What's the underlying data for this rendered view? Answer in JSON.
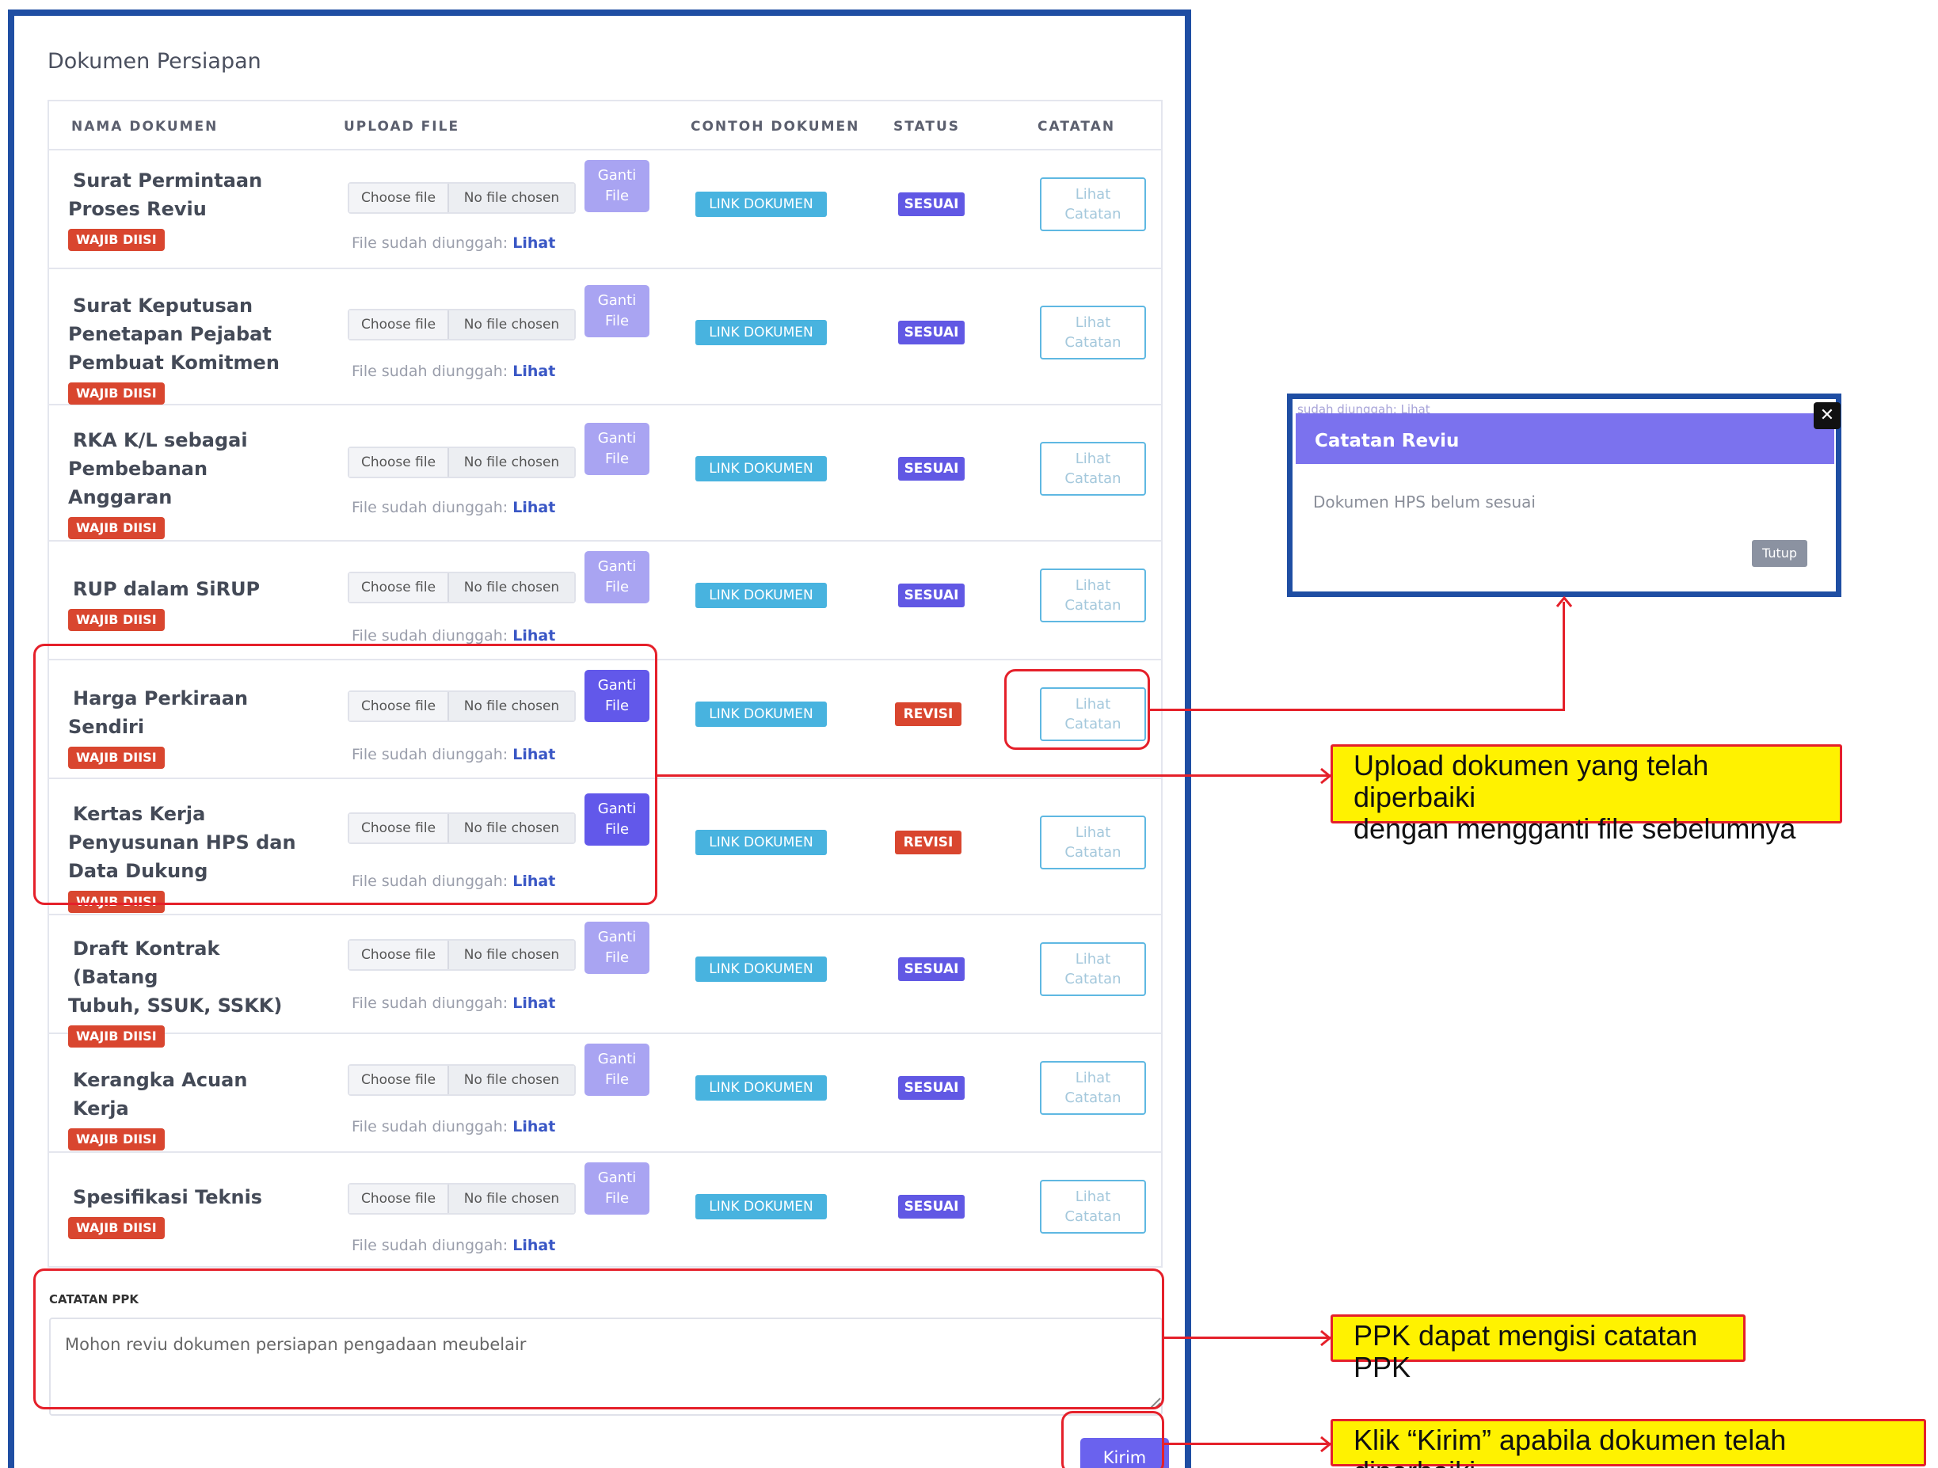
{
  "section_title": "Dokumen Persiapan",
  "table": {
    "headers": [
      "NAMA DOKUMEN",
      "UPLOAD FILE",
      "CONTOH DOKUMEN",
      "STATUS",
      "CATATAN"
    ],
    "rows": [
      {
        "name_lines": [
          "Surat Permintaan",
          "Proses Reviu"
        ],
        "badge": "WAJIB DIISI",
        "choose": "Choose file",
        "no_file": "No file chosen",
        "ganti_lines": [
          "Ganti",
          "File"
        ],
        "uploaded": "File sudah diunggah:",
        "lihat": "Lihat",
        "link": "LINK DOKUMEN",
        "status": "SESUAI",
        "catatan_lines": [
          "Lihat",
          "Catatan"
        ]
      },
      {
        "name_lines": [
          "Surat Keputusan",
          "Penetapan Pejabat",
          "Pembuat Komitmen"
        ],
        "badge": "WAJIB DIISI",
        "choose": "Choose file",
        "no_file": "No file chosen",
        "ganti_lines": [
          "Ganti",
          "File"
        ],
        "uploaded": "File sudah diunggah:",
        "lihat": "Lihat",
        "link": "LINK DOKUMEN",
        "status": "SESUAI",
        "catatan_lines": [
          "Lihat",
          "Catatan"
        ]
      },
      {
        "name_lines": [
          "RKA K/L sebagai",
          "Pembebanan",
          "Anggaran"
        ],
        "badge": "WAJIB DIISI",
        "choose": "Choose file",
        "no_file": "No file chosen",
        "ganti_lines": [
          "Ganti",
          "File"
        ],
        "uploaded": "File sudah diunggah:",
        "lihat": "Lihat",
        "link": "LINK DOKUMEN",
        "status": "SESUAI",
        "catatan_lines": [
          "Lihat",
          "Catatan"
        ]
      },
      {
        "name_lines": [
          "RUP dalam SiRUP"
        ],
        "badge": "WAJIB DIISI",
        "choose": "Choose file",
        "no_file": "No file chosen",
        "ganti_lines": [
          "Ganti",
          "File"
        ],
        "uploaded": "File sudah diunggah:",
        "lihat": "Lihat",
        "link": "LINK DOKUMEN",
        "status": "SESUAI",
        "catatan_lines": [
          "Lihat",
          "Catatan"
        ]
      },
      {
        "name_lines": [
          "Harga Perkiraan",
          "Sendiri"
        ],
        "badge": "WAJIB DIISI",
        "choose": "Choose file",
        "no_file": "No file chosen",
        "ganti_lines": [
          "Ganti",
          "File"
        ],
        "uploaded": "File sudah diunggah:",
        "lihat": "Lihat",
        "link": "LINK DOKUMEN",
        "status": "REVISI",
        "catatan_lines": [
          "Lihat",
          "Catatan"
        ]
      },
      {
        "name_lines": [
          "Kertas Kerja",
          "Penyusunan HPS dan",
          "Data Dukung"
        ],
        "badge": "WAJIB DIISI",
        "choose": "Choose file",
        "no_file": "No file chosen",
        "ganti_lines": [
          "Ganti",
          "File"
        ],
        "uploaded": "File sudah diunggah:",
        "lihat": "Lihat",
        "link": "LINK DOKUMEN",
        "status": "REVISI",
        "catatan_lines": [
          "Lihat",
          "Catatan"
        ]
      },
      {
        "name_lines": [
          "Draft Kontrak (Batang",
          "Tubuh, SSUK, SSKK)"
        ],
        "badge": "WAJIB DIISI",
        "choose": "Choose file",
        "no_file": "No file chosen",
        "ganti_lines": [
          "Ganti",
          "File"
        ],
        "uploaded": "File sudah diunggah:",
        "lihat": "Lihat",
        "link": "LINK DOKUMEN",
        "status": "SESUAI",
        "catatan_lines": [
          "Lihat",
          "Catatan"
        ]
      },
      {
        "name_lines": [
          "Kerangka Acuan Kerja"
        ],
        "badge": "WAJIB DIISI",
        "choose": "Choose file",
        "no_file": "No file chosen",
        "ganti_lines": [
          "Ganti",
          "File"
        ],
        "uploaded": "File sudah diunggah:",
        "lihat": "Lihat",
        "link": "LINK DOKUMEN",
        "status": "SESUAI",
        "catatan_lines": [
          "Lihat",
          "Catatan"
        ]
      },
      {
        "name_lines": [
          "Spesifikasi Teknis"
        ],
        "badge": "WAJIB DIISI",
        "choose": "Choose file",
        "no_file": "No file chosen",
        "ganti_lines": [
          "Ganti",
          "File"
        ],
        "uploaded": "File sudah diunggah:",
        "lihat": "Lihat",
        "link": "LINK DOKUMEN",
        "status": "SESUAI",
        "catatan_lines": [
          "Lihat",
          "Catatan"
        ]
      }
    ]
  },
  "catatan_ppk": {
    "label": "CATATAN PPK",
    "value": "Mohon reviu dokumen persiapan pengadaan meubelair"
  },
  "kirim_label": "Kirim",
  "modal": {
    "bleed_text": "sudah diunggah: Lihat",
    "title": "Catatan Reviu",
    "close_glyph": "✕",
    "body": "Dokumen HPS belum sesuai",
    "tutup_label": "Tutup"
  },
  "callouts": {
    "upload_lines": [
      "Upload dokumen yang telah diperbaiki",
      "dengan mengganti file sebelumnya"
    ],
    "ppk": "PPK dapat mengisi catatan PPK",
    "kirim": "Klik “Kirim” apabila dokumen telah diperbaiki"
  },
  "colors": {
    "frame": "#1f4ea3",
    "primary": "#6258ea",
    "danger": "#d9462f",
    "info": "#48b3df",
    "highlight": "#e5202a",
    "callout_bg": "#fff200"
  }
}
